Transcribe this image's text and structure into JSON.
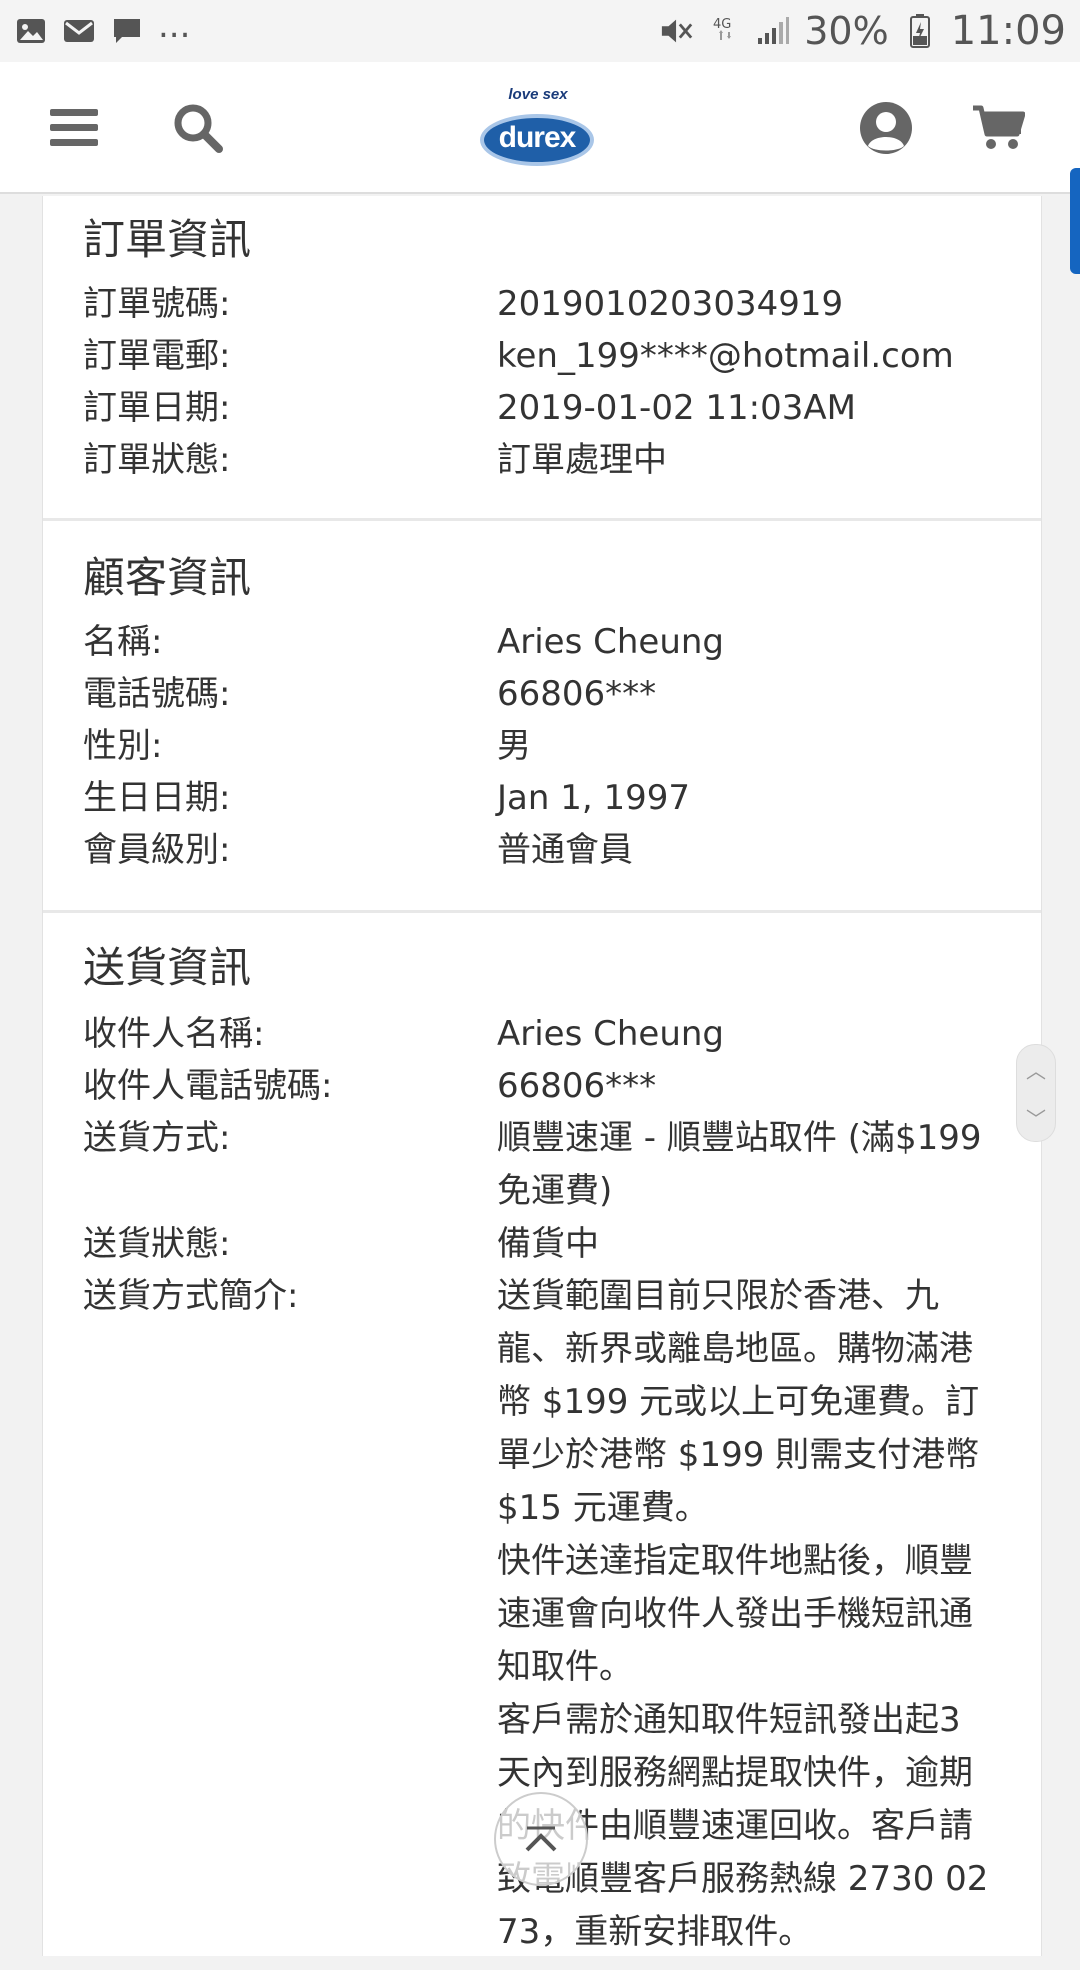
{
  "status_bar": {
    "icons": [
      "image-icon",
      "mail-icon",
      "chat-icon"
    ],
    "more": "...",
    "right_icons": [
      "mute-icon",
      "4g-icon",
      "signal-icon"
    ],
    "battery": "30%",
    "time": "11:09"
  },
  "header": {
    "logo_tagline": "love sex",
    "logo_word": "durex"
  },
  "order_info": {
    "title": "訂單資訊",
    "rows": [
      {
        "label": "訂單號碼:",
        "value": "2019010203034919"
      },
      {
        "label": "訂單電郵:",
        "value": "ken_199****@hotmail.com"
      },
      {
        "label": "訂單日期:",
        "value": "2019-01-02 11:03AM"
      },
      {
        "label": "訂單狀態:",
        "value": "訂單處理中"
      }
    ]
  },
  "customer_info": {
    "title": "顧客資訊",
    "rows": [
      {
        "label": "名稱:",
        "value": "Aries Cheung"
      },
      {
        "label": "電話號碼:",
        "value": "66806***"
      },
      {
        "label": "性別:",
        "value": "男"
      },
      {
        "label": "生日日期:",
        "value": "Jan 1, 1997"
      },
      {
        "label": "會員級別:",
        "value": "普通會員"
      }
    ]
  },
  "delivery_info": {
    "title": "送貨資訊",
    "rows": [
      {
        "label": "收件人名稱:",
        "value": "Aries Cheung"
      },
      {
        "label": "收件人電話號碼:",
        "value": "66806***"
      },
      {
        "label": "送貨方式:",
        "value": "順豐速運 - 順豐站取件 (滿$199免運費)"
      },
      {
        "label": "送貨狀態:",
        "value": "備貨中"
      },
      {
        "label": "送貨方式簡介:",
        "value": "送貨範圍目前只限於香港、九龍、新界或離島地區。購物滿港幣 $199 元或以上可免運費。訂單少於港幣 $199 則需支付港幣 $15 元運費。\n快件送達指定取件地點後，順豐速運會向收件人發出手機短訊通知取件。\n客戶需於通知取件短訊發出起3天內到服務網點提取快件，逾期的快件由順豐速運回收。客戶請致電順豐客戶服務熱線 2730 02 73，重新安排取件。"
      }
    ]
  }
}
